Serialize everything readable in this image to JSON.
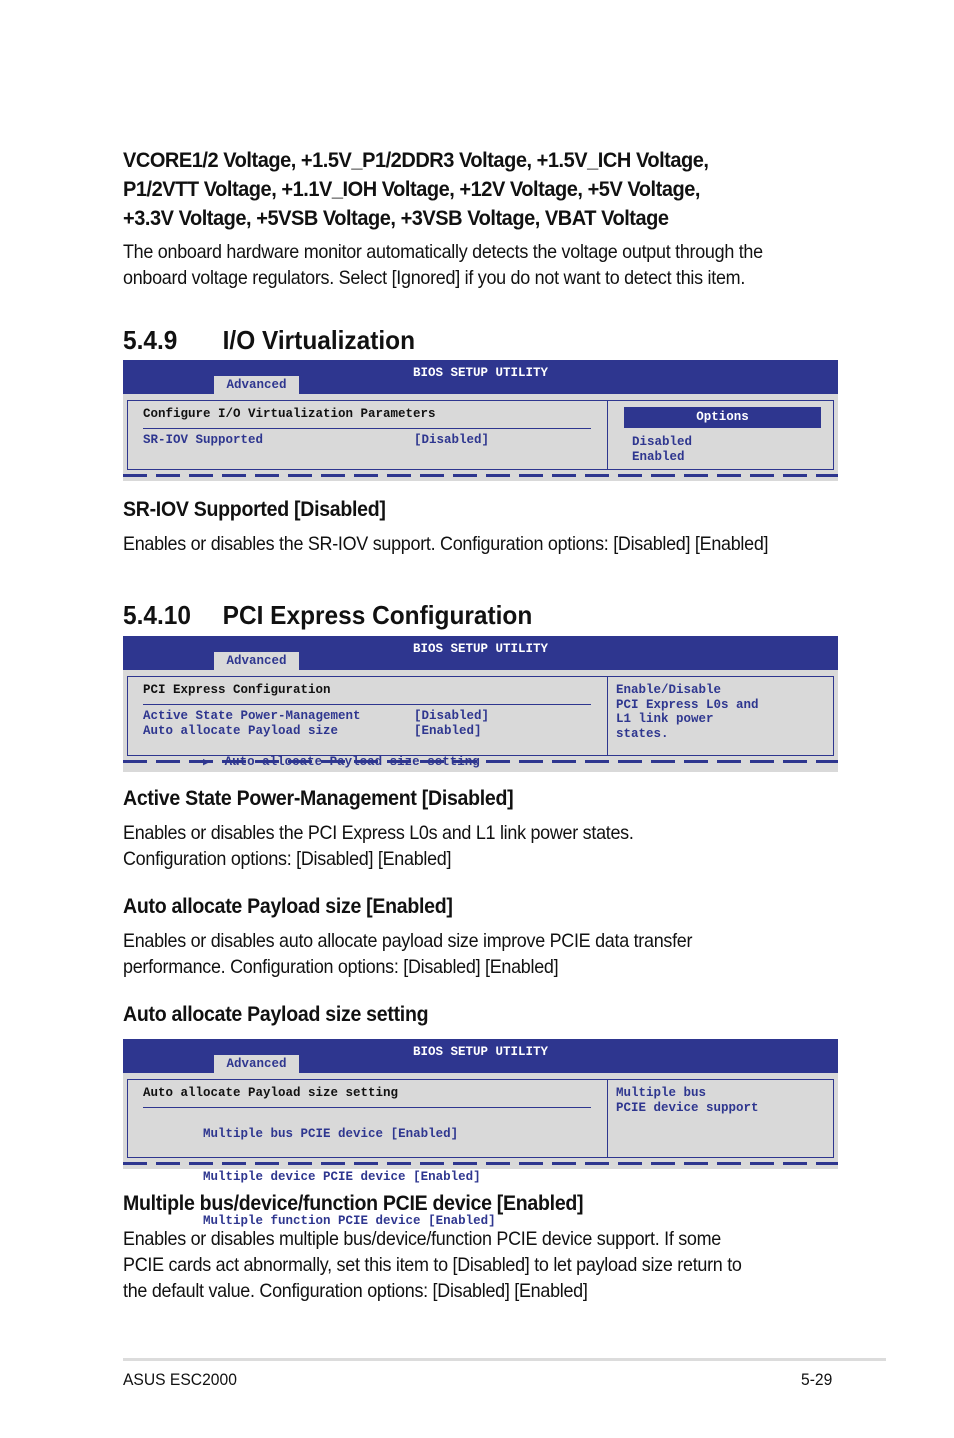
{
  "voltage_section": {
    "heading_lines": [
      "VCORE1/2 Voltage, +1.5V_P1/2DDR3 Voltage, +1.5V_ICH Voltage,",
      "P1/2VTT Voltage, +1.1V_IOH Voltage, +12V Voltage, +5V Voltage,",
      "+3.3V Voltage, +5VSB Voltage, +3VSB Voltage, VBAT Voltage"
    ],
    "body_lines": [
      "The onboard hardware monitor automatically detects the voltage output through the",
      "onboard voltage regulators. Select [Ignored] if you do not want to detect this item."
    ]
  },
  "section_549": {
    "number": "5.4.9",
    "title": "I/O Virtualization",
    "bios": {
      "title": "BIOS SETUP UTILITY",
      "tab": "Advanced",
      "panel_title": "Configure I/O Virtualization Parameters",
      "items": [
        {
          "label": "SR-IOV Supported",
          "value": "[Disabled]"
        }
      ],
      "options_header": "Options",
      "options": [
        "Disabled",
        "Enabled"
      ]
    },
    "subsections": [
      {
        "heading": "SR-IOV Supported [Disabled]",
        "body_lines": [
          "Enables or disables the SR-IOV support. Configuration options: [Disabled] [Enabled]"
        ]
      }
    ]
  },
  "section_5410": {
    "number": "5.4.10",
    "title": "PCI Express Configuration",
    "bios": {
      "title": "BIOS SETUP UTILITY",
      "tab": "Advanced",
      "panel_title": "PCI Express Configuration",
      "items": [
        {
          "label": "Active State Power-Management",
          "value": "[Disabled]"
        },
        {
          "label": "Auto allocate Payload size",
          "value": "[Enabled]"
        }
      ],
      "submenu_arrow": "▶",
      "submenu": "Auto allocate Payload size setting",
      "help_lines": [
        "Enable/Disable",
        "PCI Express L0s and",
        "L1 link power",
        "states."
      ]
    },
    "subsections": [
      {
        "heading": "Active State Power-Management [Disabled]",
        "body_lines": [
          "Enables or disables the PCI Express L0s and L1 link power states.",
          "Configuration options: [Disabled] [Enabled]"
        ]
      },
      {
        "heading": "Auto allocate Payload size [Enabled]",
        "body_lines": [
          "Enables or disables auto allocate payload size improve PCIE data transfer",
          "performance. Configuration options: [Disabled] [Enabled]"
        ]
      },
      {
        "heading": "Auto allocate Payload size setting",
        "body_lines": []
      }
    ],
    "bios2": {
      "title": "BIOS SETUP UTILITY",
      "tab": "Advanced",
      "panel_title": "Auto allocate Payload size setting",
      "items": [
        {
          "label": "Multiple bus PCIE device",
          "value": "[Enabled]"
        },
        {
          "label": "Multiple device PCIE device",
          "value": "[Enabled]"
        },
        {
          "label": "Multiple function PCIE device",
          "value": "[Enabled]"
        }
      ],
      "help_lines": [
        "Multiple bus",
        "PCIE device support"
      ]
    },
    "final": {
      "heading": "Multiple bus/device/function PCIE device [Enabled]",
      "body_lines": [
        "Enables or disables multiple bus/device/function PCIE device support. If some",
        "PCIE cards act abnormally, set this item to [Disabled] to let payload size return to",
        "the default value. Configuration options: [Disabled] [Enabled]"
      ]
    }
  },
  "footer": {
    "product": "ASUS ESC2000",
    "page": "5-29"
  },
  "colors": {
    "bios_blue": "#2e368f",
    "bios_gray": "#d9d9d9"
  }
}
